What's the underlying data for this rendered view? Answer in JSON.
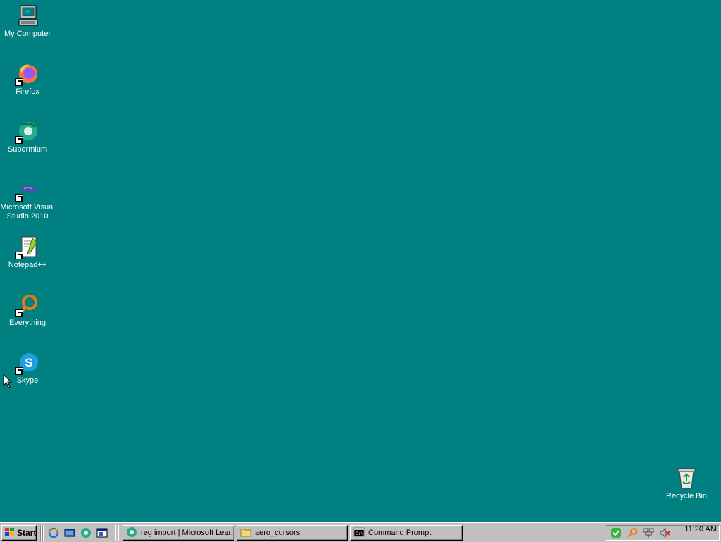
{
  "desktop": {
    "icons": [
      {
        "label": "My Computer"
      },
      {
        "label": "Firefox"
      },
      {
        "label": "Supermium"
      },
      {
        "label": "Microsoft Visual\nStudio 2010"
      },
      {
        "label": "Notepad++"
      },
      {
        "label": "Everything"
      },
      {
        "label": "Skype"
      },
      {
        "label": "Recycle Bin"
      }
    ]
  },
  "taskbar": {
    "start_label": "Start",
    "tasks": [
      {
        "label": "reg import | Microsoft Lear...",
        "icon": "supermium-icon"
      },
      {
        "label": "aero_cursors",
        "icon": "folder-icon"
      },
      {
        "label": "Command Prompt",
        "icon": "cmd-icon"
      }
    ],
    "clock": "11:20 AM"
  },
  "colors": {
    "desktop_bg": "#008080",
    "taskbar_bg": "#c0c0c0"
  }
}
